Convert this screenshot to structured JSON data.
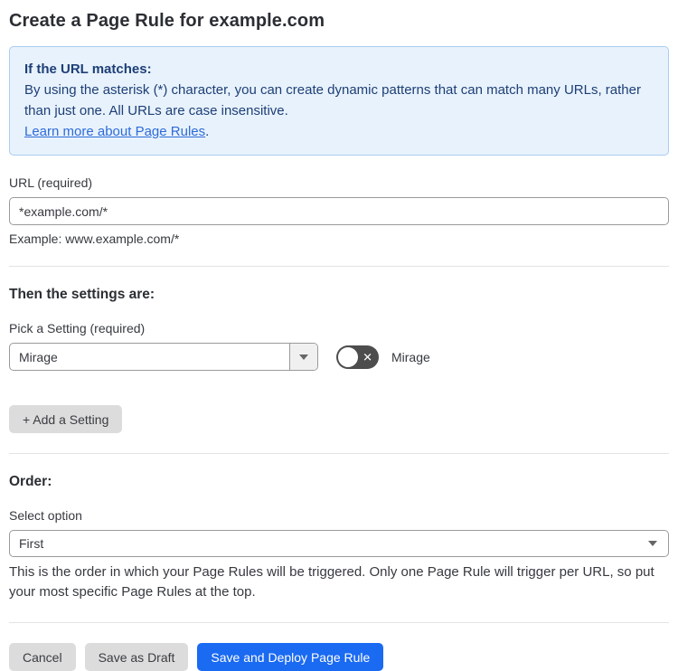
{
  "page": {
    "title": "Create a Page Rule for example.com"
  },
  "info_box": {
    "heading": "If the URL matches:",
    "body": "By using the asterisk (*) character, you can create dynamic patterns that can match many URLs, rather than just one. All URLs are case insensitive.",
    "link_label": "Learn more about Page Rules",
    "link_suffix": "."
  },
  "url_field": {
    "label": "URL (required)",
    "value": "*example.com/*",
    "helper": "Example: www.example.com/*"
  },
  "settings_section": {
    "heading": "Then the settings are:",
    "picker_label": "Pick a Setting (required)",
    "picker_value": "Mirage",
    "toggle_label": "Mirage",
    "toggle_state": "off",
    "toggle_glyph": "✕",
    "add_button_label": "+ Add a Setting"
  },
  "order_section": {
    "heading": "Order:",
    "select_label": "Select option",
    "select_value": "First",
    "helper": "This is the order in which your Page Rules will be triggered. Only one Page Rule will trigger per URL, so put your most specific Page Rules at the top."
  },
  "footer": {
    "cancel_label": "Cancel",
    "save_draft_label": "Save as Draft",
    "save_deploy_label": "Save and Deploy Page Rule"
  },
  "colors": {
    "accent_blue": "#1a6af2",
    "info_background": "#e8f2fc",
    "info_border": "#a9cdf0",
    "info_text": "#1d3f77",
    "link_blue": "#2e6bd8",
    "toggle_off_background": "#4d4d4d",
    "button_gray": "#dcdcdc"
  }
}
